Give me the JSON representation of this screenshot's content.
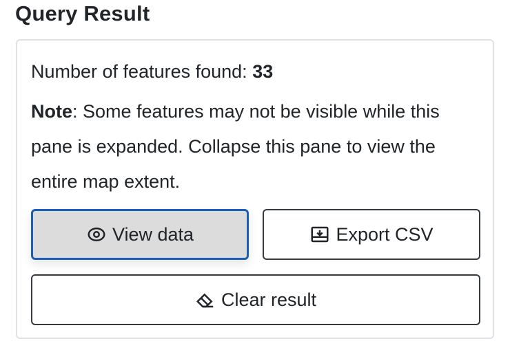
{
  "header": {
    "title": "Query Result"
  },
  "result": {
    "count_label": "Number of features found: ",
    "count_value": "33",
    "note_label": "Note",
    "note_text": ": Some features may not be visible while this pane is expanded. Collapse this pane to view the entire map extent."
  },
  "actions": {
    "view_label": "View data",
    "view_icon": "eye-icon",
    "export_label": "Export CSV",
    "export_icon": "export-icon",
    "clear_label": "Clear result",
    "clear_icon": "eraser-icon"
  },
  "colors": {
    "focus_border": "#1a5fb4",
    "active_button_bg": "#dcdcdc",
    "text": "#212529"
  }
}
